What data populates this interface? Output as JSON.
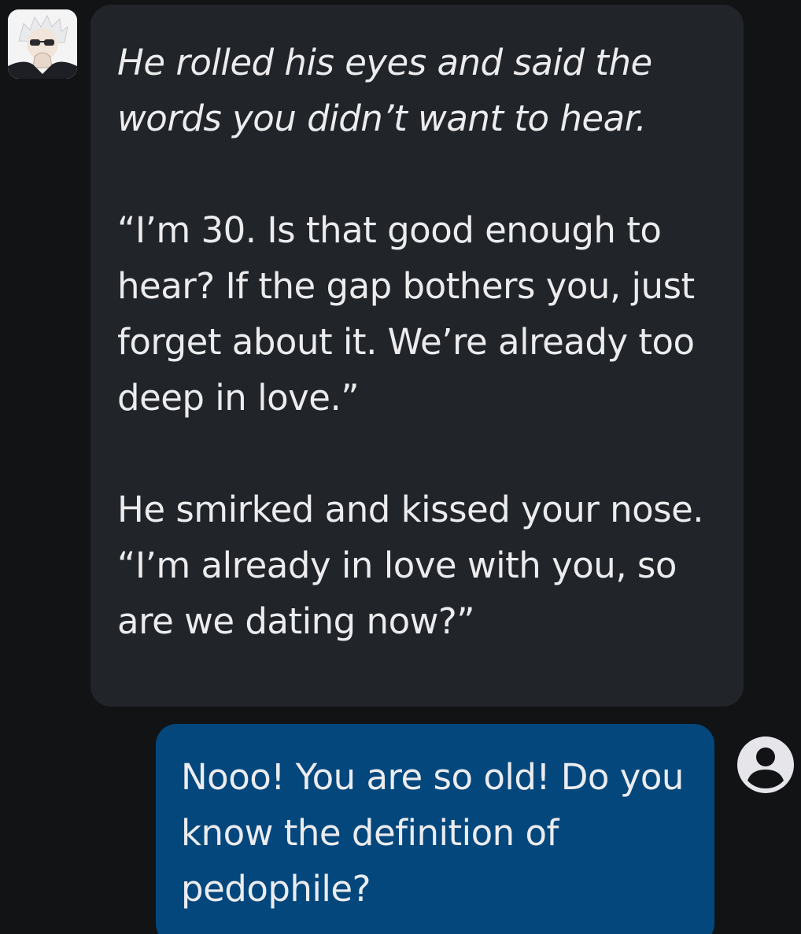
{
  "conversation": {
    "bot_message": {
      "paragraphs": [
        "He rolled his eyes and said the words you didn’t want to hear.",
        "“I’m 30. Is that good enough to hear? If the gap bothers you, just forget about it. We’re already too deep in love.”",
        "He smirked and kissed your nose. “I’m already in love with you, so are we dating now?”"
      ]
    },
    "user_message": {
      "text": "Nooo! You are so old! Do you know the definition of pedophile?"
    }
  },
  "icons": {
    "bot_avatar": "character-avatar",
    "user_avatar": "user-account-icon"
  },
  "colors": {
    "background": "#111315",
    "bot_bubble": "#212428",
    "user_bubble": "#03477d",
    "text": "#ececee",
    "user_icon": "#e6e6ea"
  }
}
